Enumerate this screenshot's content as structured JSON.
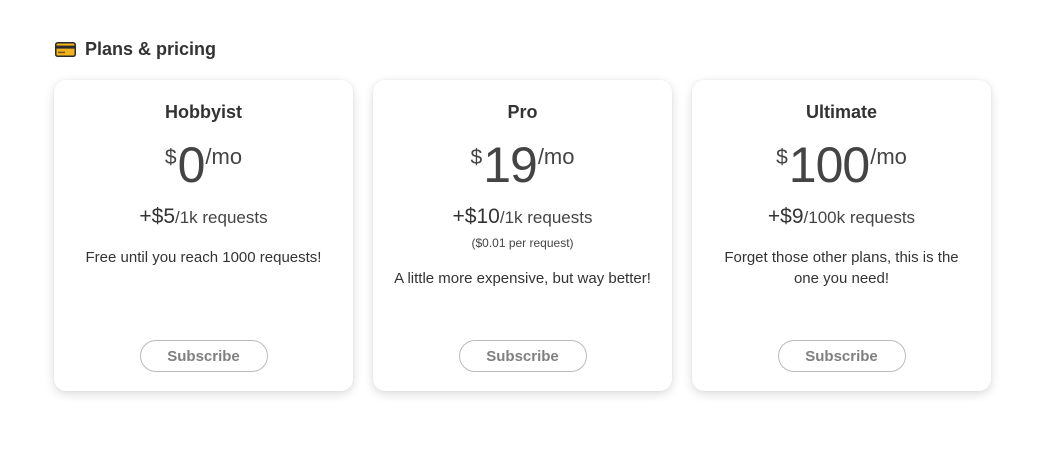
{
  "section": {
    "title": "Plans & pricing",
    "icon": "credit-card-icon"
  },
  "colors": {
    "text": "#333333",
    "button_text": "#808080",
    "button_border": "#bbbbbb",
    "card_background": "#ffffff",
    "icon_gold": "#f2b41e"
  },
  "plans": [
    {
      "name": "Hobbyist",
      "currency": "$",
      "amount": "0",
      "period": "/mo",
      "usage_price": "+$5",
      "usage_unit": "/1k requests",
      "usage_note": "",
      "description": "Free until you reach 1000 requests!",
      "button_label": "Subscribe"
    },
    {
      "name": "Pro",
      "currency": "$",
      "amount": "19",
      "period": "/mo",
      "usage_price": "+$10",
      "usage_unit": "/1k requests",
      "usage_note": "($0.01 per request)",
      "description": "A little more expensive, but way better!",
      "button_label": "Subscribe"
    },
    {
      "name": "Ultimate",
      "currency": "$",
      "amount": "100",
      "period": "/mo",
      "usage_price": "+$9",
      "usage_unit": "/100k requests",
      "usage_note": "",
      "description": "Forget those other plans, this is the one you need!",
      "button_label": "Subscribe"
    }
  ]
}
